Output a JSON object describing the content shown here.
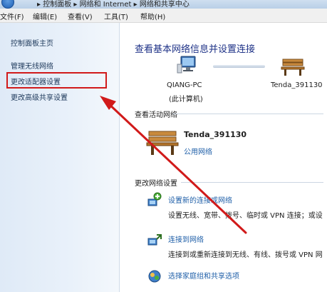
{
  "address_bar": {
    "path": "▸ 控制面板 ▸ 网络和 Internet ▸ 网络和共享中心"
  },
  "menu": [
    "文件(F)",
    "编辑(E)",
    "查看(V)",
    "工具(T)",
    "帮助(H)"
  ],
  "sidebar": {
    "items": [
      {
        "label": "控制面板主页"
      },
      {
        "label": "管理无线网络"
      },
      {
        "label": "更改适配器设置"
      },
      {
        "label": "更改高级共享设置"
      }
    ]
  },
  "main": {
    "title": "查看基本网络信息并设置连接",
    "network_map": {
      "computer_name": "QIANG-PC",
      "computer_sub": "(此计算机)",
      "network_name": "Tenda_391130"
    },
    "active_section": {
      "heading": "查看活动网络",
      "network_name": "Tenda_391130",
      "network_type": "公用网络"
    },
    "change_section": {
      "heading": "更改网络设置",
      "tasks": [
        {
          "title": "设置新的连接或网络",
          "desc": "设置无线、宽带、拨号、临时或 VPN 连接；或设"
        },
        {
          "title": "连接到网络",
          "desc": "连接到或重新连接到无线、有线、拨号或 VPN 网"
        },
        {
          "title": "选择家庭组和共享选项",
          "desc": ""
        }
      ]
    }
  },
  "colors": {
    "annotation": "#d11a1a",
    "link": "#1f5fa8",
    "title": "#1e3287"
  }
}
